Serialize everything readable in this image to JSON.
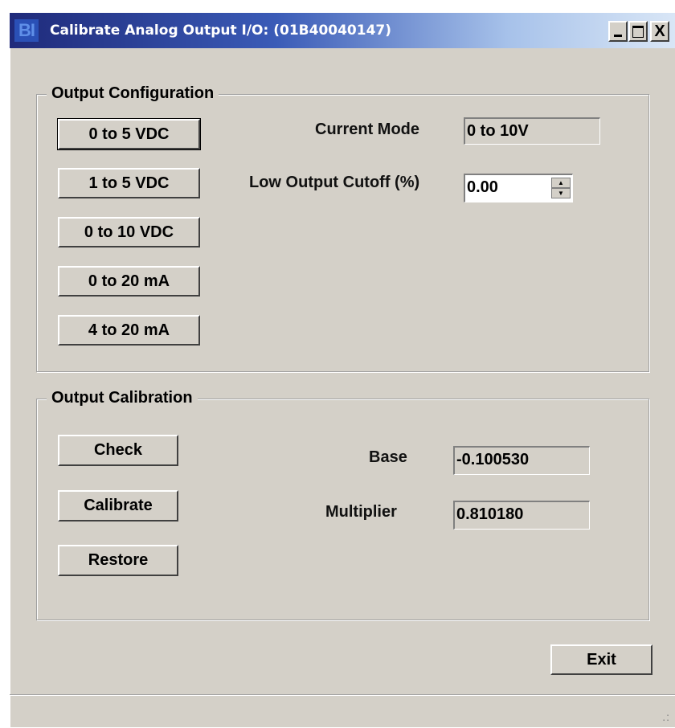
{
  "window": {
    "title": "Calibrate Analog Output I/O: (01B40040147)",
    "app_icon_text": "BI",
    "controls": {
      "minimize": "_",
      "maximize": "□",
      "close": "X"
    }
  },
  "output_configuration": {
    "group_title": "Output Configuration",
    "mode_buttons": [
      "0 to 5 VDC",
      "1 to 5 VDC",
      "0 to 10 VDC",
      "0 to 20 mA",
      "4 to 20 mA"
    ],
    "current_mode_label": "Current Mode",
    "current_mode_value": "0 to 10V",
    "low_cutoff_label": "Low Output Cutoff (%)",
    "low_cutoff_value": "0.00"
  },
  "output_calibration": {
    "group_title": "Output Calibration",
    "check_label": "Check",
    "calibrate_label": "Calibrate",
    "restore_label": "Restore",
    "base_label": "Base",
    "base_value": "-0.100530",
    "multiplier_label": "Multiplier",
    "multiplier_value": "0.810180"
  },
  "footer": {
    "exit_label": "Exit"
  }
}
